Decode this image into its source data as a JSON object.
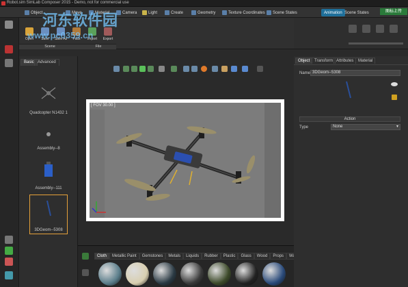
{
  "window": {
    "title": "Robot.sim SimLab Composer 2015 - Demo, not for commercial use"
  },
  "tabs": [
    {
      "label": "Object",
      "icon": "object-icon"
    },
    {
      "label": "Move",
      "icon": "move-icon"
    },
    {
      "label": "Material",
      "icon": "material-icon"
    },
    {
      "label": "Camera",
      "icon": "camera-icon"
    },
    {
      "label": "Light",
      "icon": "light-icon"
    },
    {
      "label": "Create",
      "icon": "create-icon"
    },
    {
      "label": "Geometry",
      "icon": "geometry-icon"
    },
    {
      "label": "Texture Coordinates",
      "icon": "texture-icon"
    },
    {
      "label": "Scene States",
      "icon": "scene-states-icon"
    },
    {
      "label": "Animation",
      "icon": "animation-icon",
      "active": true
    },
    {
      "label": "Scene States",
      "icon": "scene-states-icon"
    }
  ],
  "ribbon": {
    "buttons": [
      {
        "label": "Open",
        "color": "#d9a43a"
      },
      {
        "label": "Save",
        "color": "#6a8fc0"
      },
      {
        "label": "Save As",
        "color": "#6a8fc0"
      },
      {
        "label": "Pack",
        "color": "#b07a3a"
      },
      {
        "label": "Import",
        "color": "#5aa05a"
      },
      {
        "label": "Export",
        "color": "#a05a5a"
      }
    ],
    "groups": [
      "Scene",
      "File"
    ]
  },
  "top_right": {
    "upload_label": "图标上传"
  },
  "library": {
    "tabs": [
      {
        "label": "Basic",
        "active": true
      },
      {
        "label": "Advanced"
      }
    ],
    "items": [
      {
        "label": "Quadcopter N1432 1"
      },
      {
        "label": "Assembly--8"
      },
      {
        "label": "Assembly--111"
      },
      {
        "label": "3DGeom--5308",
        "selected": true
      }
    ]
  },
  "viewport": {
    "fov_label": "[ FOV 30.00 ]"
  },
  "materials": {
    "tabs": [
      "Cloth",
      "Metallic Paint",
      "Gemstones",
      "Metals",
      "Liquids",
      "Rubber",
      "Plastic",
      "Glass",
      "Wood",
      "Props",
      "Wall"
    ],
    "active_tab": "Cloth",
    "swatch_colors": [
      "#5a7d8a",
      "#d8cfb0",
      "#2b3a44",
      "#3a3a3a",
      "#3d4a2a",
      "#222222",
      "#2a4a7a"
    ]
  },
  "properties": {
    "tabs": [
      {
        "label": "Object",
        "active": true
      },
      {
        "label": "Transform"
      },
      {
        "label": "Attributes"
      },
      {
        "label": "Material"
      }
    ],
    "name_label": "Name",
    "name_value": "3DGeom--5308",
    "action_header": "Action",
    "type_label": "Type",
    "type_value": "None"
  },
  "watermarks": [
    "河东软件园",
    "www.pc0359.cn"
  ]
}
